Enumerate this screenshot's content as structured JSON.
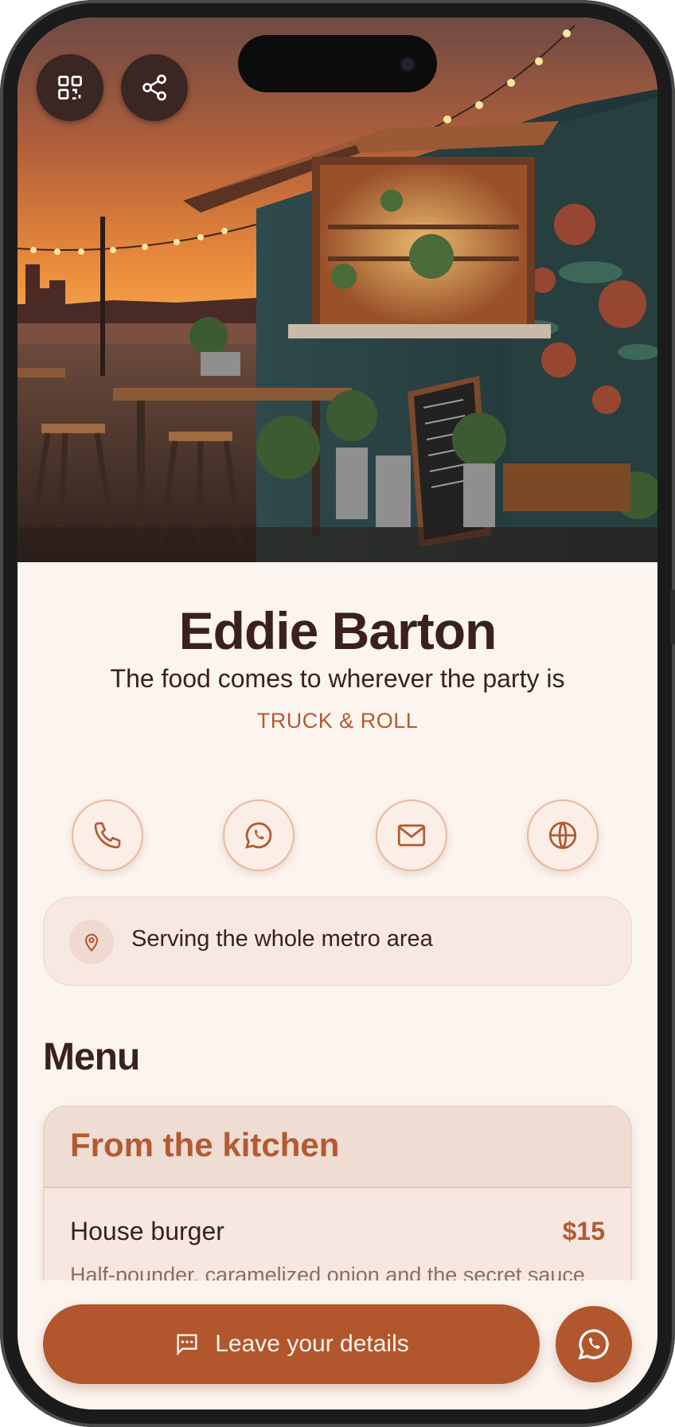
{
  "profile": {
    "name": "Eddie Barton",
    "tagline": "The food comes to wherever the party is",
    "company": "TRUCK & ROLL"
  },
  "header_actions": {
    "qr_icon": "qr-code-icon",
    "share_icon": "share-icon"
  },
  "contact_actions": [
    {
      "icon": "phone-icon"
    },
    {
      "icon": "whatsapp-icon"
    },
    {
      "icon": "mail-icon"
    },
    {
      "icon": "globe-icon"
    }
  ],
  "location": {
    "icon": "map-pin-icon",
    "text": "Serving the whole metro area"
  },
  "menu": {
    "title": "Menu",
    "sections": [
      {
        "title": "From the kitchen",
        "items": [
          {
            "name": "House burger",
            "price": "$15",
            "description": "Half-pounder, caramelized onion and the secret sauce"
          }
        ]
      }
    ]
  },
  "bottom_bar": {
    "cta_label": "Leave your details",
    "cta_icon": "message-icon",
    "whatsapp_icon": "whatsapp-icon"
  },
  "colors": {
    "accent": "#b2562d",
    "text_dark": "#3a211c",
    "background": "#fcf4ef"
  }
}
